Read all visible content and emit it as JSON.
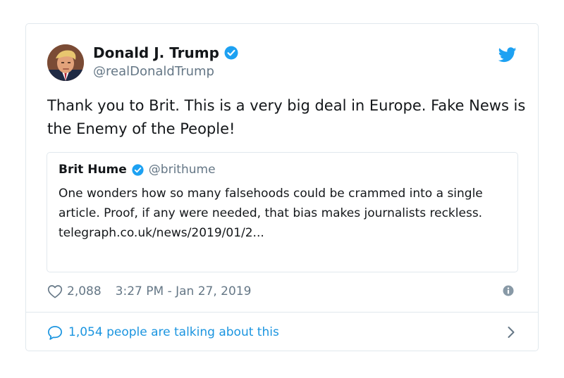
{
  "tweet": {
    "author_name": "Donald J. Trump",
    "author_handle": "@realDonaldTrump",
    "text": "Thank you to Brit. This is a very big deal in Europe. Fake News is the Enemy of the People!",
    "likes": "2,088",
    "timestamp": "3:27 PM - Jan 27, 2019",
    "talking": "1,054 people are talking about this"
  },
  "quoted": {
    "author_name": "Brit Hume",
    "author_handle": "@brithume",
    "text": "One wonders how so many falsehoods could be crammed into a single article. Proof, if any were needed, that bias makes journalists reckless.",
    "link": "telegraph.co.uk/news/2019/01/2..."
  },
  "icons": {
    "verified": "verified-badge-icon",
    "brand": "twitter-bird-icon",
    "like": "heart-icon",
    "info": "info-icon",
    "reply": "speech-bubble-icon",
    "more": "chevron-right-icon"
  },
  "colors": {
    "accent": "#1da1f2",
    "link": "#1b95e0",
    "secondary_text": "#657786",
    "border": "#e1e8ed"
  }
}
